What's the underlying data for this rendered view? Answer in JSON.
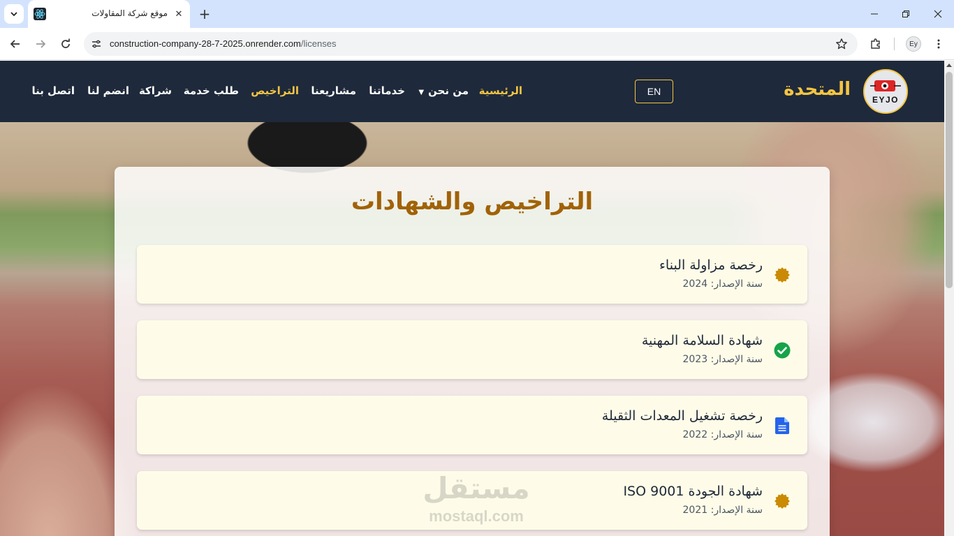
{
  "browser": {
    "tab_title": "موقع شركة المقاولات",
    "url_host": "construction-company-28-7-2025.onrender.com",
    "url_path": "/licenses",
    "profile_initials": "Ey"
  },
  "navbar": {
    "brand_name": "المتحدة",
    "logo_text": "EYJO",
    "lang_button": "EN",
    "items": [
      {
        "label": "الرئيسية",
        "active": true
      },
      {
        "label": "من نحن",
        "dropdown": true
      },
      {
        "label": "خدماتنا"
      },
      {
        "label": "مشاريعنا"
      },
      {
        "label": "التراخيص",
        "active": true
      },
      {
        "label": "طلب خدمة"
      },
      {
        "label": "شراكة"
      },
      {
        "label": "انضم لنا"
      },
      {
        "label": "اتصل بنا"
      }
    ],
    "colors": {
      "bg": "#1e293b",
      "accent": "#f5c542"
    }
  },
  "page": {
    "title": "التراخيص والشهادات",
    "licenses": [
      {
        "name": "رخصة مزاولة البناء",
        "year": "سنة الإصدار: 2024",
        "icon": "seal-icon"
      },
      {
        "name": "شهادة السلامة المهنية",
        "year": "سنة الإصدار: 2023",
        "icon": "check-circle-icon"
      },
      {
        "name": "رخصة تشغيل المعدات الثقيلة",
        "year": "سنة الإصدار: 2022",
        "icon": "document-icon"
      },
      {
        "name": "شهادة الجودة ISO 9001",
        "year": "سنة الإصدار: 2021",
        "icon": "seal-icon"
      }
    ]
  },
  "watermark": {
    "arabic": "مستقل",
    "latin": "mostaql.com"
  }
}
